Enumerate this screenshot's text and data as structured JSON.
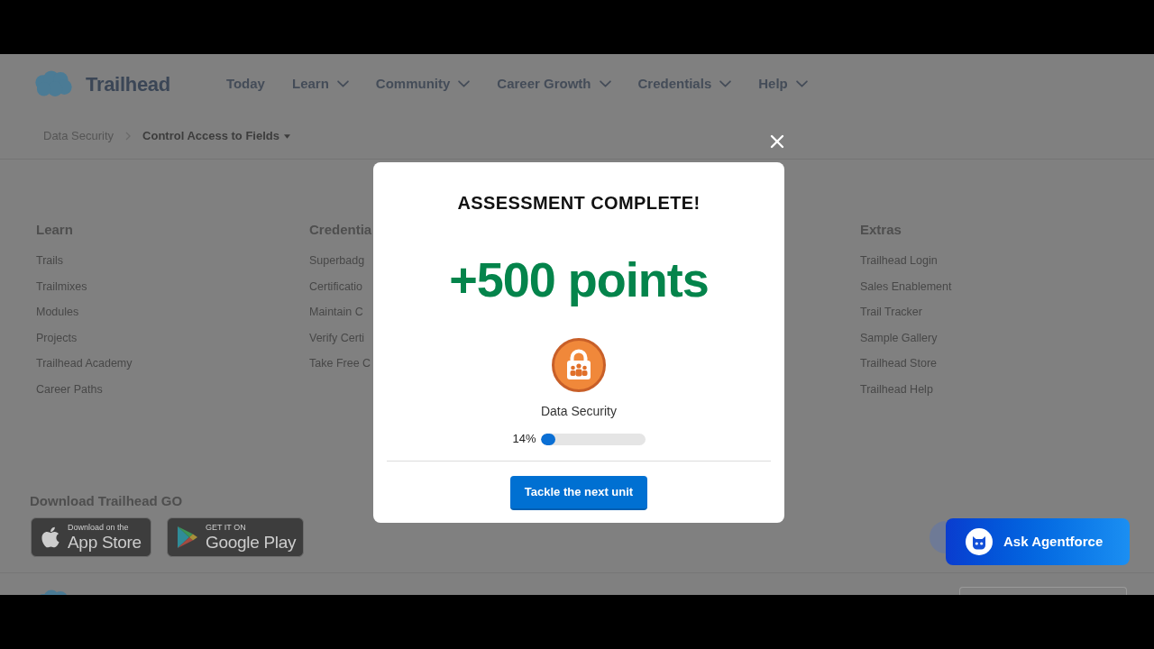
{
  "header": {
    "logo": "Trailhead",
    "nav": [
      {
        "label": "Today",
        "menu": false
      },
      {
        "label": "Learn",
        "menu": true
      },
      {
        "label": "Community",
        "menu": true
      },
      {
        "label": "Career Growth",
        "menu": true
      },
      {
        "label": "Credentials",
        "menu": true
      },
      {
        "label": "Help",
        "menu": true
      }
    ]
  },
  "breadcrumb": [
    {
      "label": "Data Security",
      "current": false
    },
    {
      "label": "Control Access to Fields",
      "current": true
    }
  ],
  "footer": {
    "columns": [
      {
        "heading": "Learn",
        "links": [
          "Trails",
          "Trailmixes",
          "Modules",
          "Projects",
          "Trailhead Academy",
          "Career Paths"
        ]
      },
      {
        "heading": "Credentia",
        "links": [
          "Superbadg",
          "Certificatio",
          "Maintain C",
          "Verify Certi",
          "Take Free C"
        ]
      },
      {
        "heading": "Extras",
        "links": [
          "Trailhead Login",
          "Sales Enablement",
          "Trail Tracker",
          "Sample Gallery",
          "Trailhead Store",
          "Trailhead Help"
        ]
      }
    ],
    "app_download": {
      "heading": "Download Trailhead GO",
      "badges": [
        {
          "kind": "apple",
          "caption": "Download on the",
          "store": "App Store"
        },
        {
          "kind": "google",
          "caption": "GET IT ON",
          "store": "Google Play"
        }
      ]
    }
  },
  "modal": {
    "title": "ASSESSMENT COMPLETE!",
    "points": "+500 points",
    "badge_label": "Data Security",
    "progress": {
      "reading": "14%",
      "level": 0.14
    },
    "button": "Tackle the next unit"
  },
  "assistant_button": {
    "label": "Ask Agentforce"
  }
}
